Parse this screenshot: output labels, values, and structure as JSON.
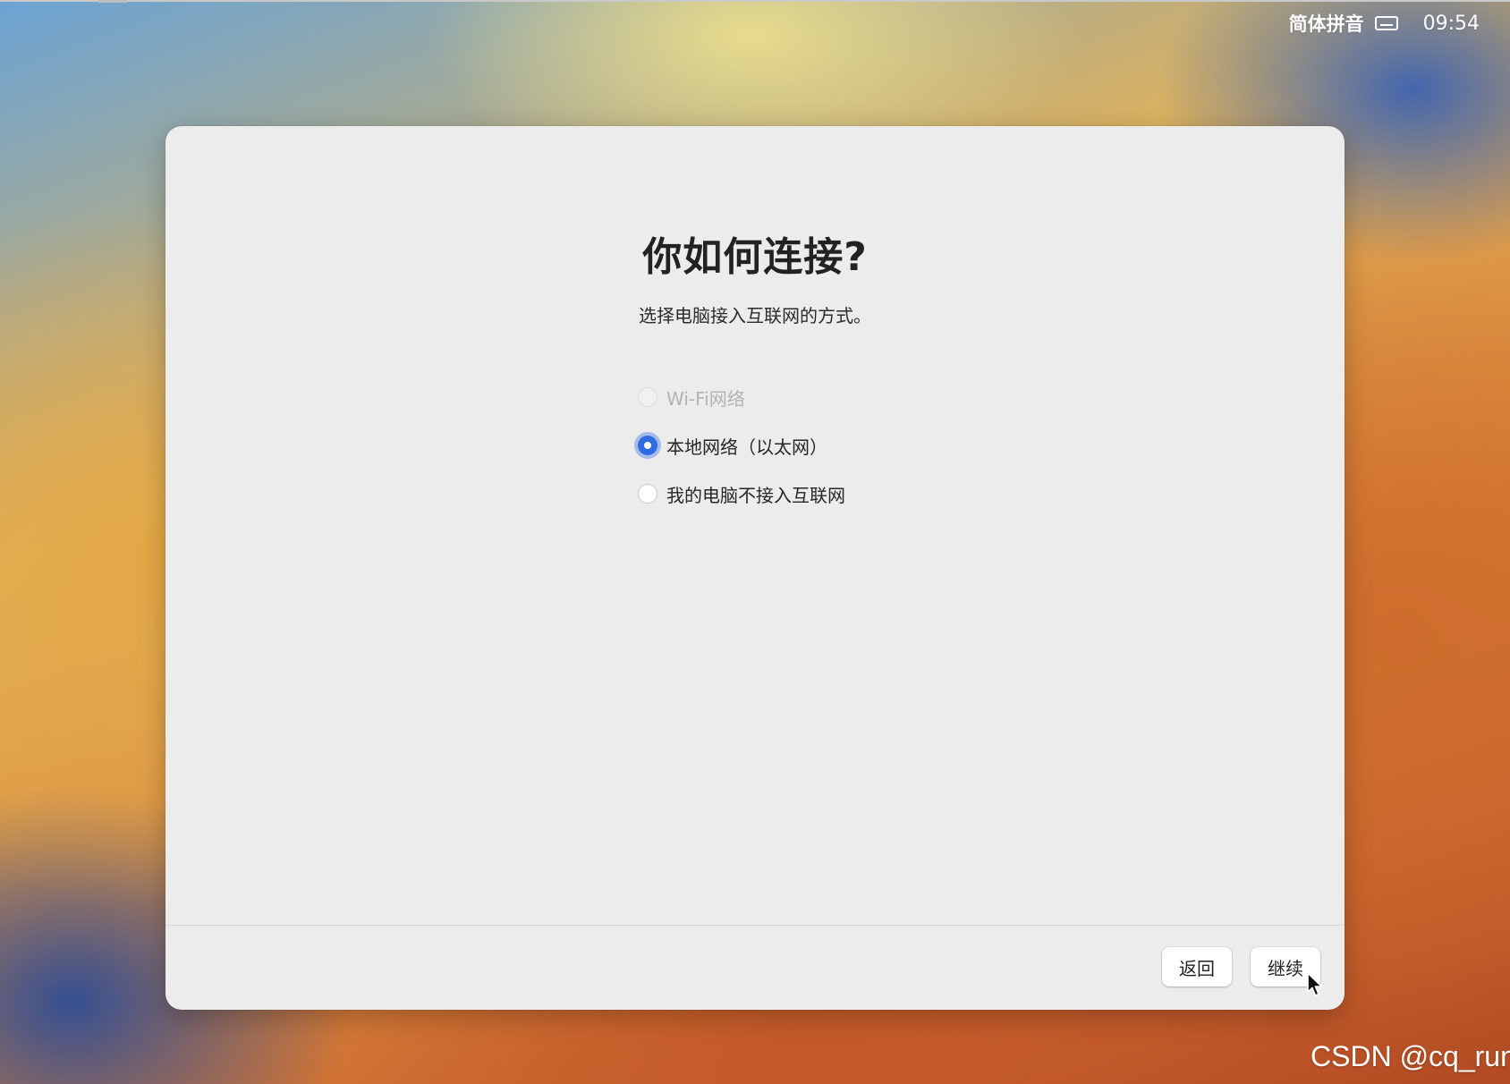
{
  "menubar": {
    "input_method": "简体拼音",
    "keyboard_icon": "keyboard-icon",
    "time": "09:54"
  },
  "dialog": {
    "title": "你如何连接?",
    "subtitle": "选择电脑接入互联网的方式。",
    "options": [
      {
        "label": "Wi-Fi网络",
        "state": "disabled"
      },
      {
        "label": "本地网络（以太网）",
        "state": "selected"
      },
      {
        "label": "我的电脑不接入互联网",
        "state": "unselected"
      }
    ],
    "buttons": {
      "back": "返回",
      "continue": "继续"
    }
  },
  "accent_color": "#2f6ae0",
  "cursor_icon": "pointer-cursor-icon",
  "watermark": "CSDN @cq_run"
}
